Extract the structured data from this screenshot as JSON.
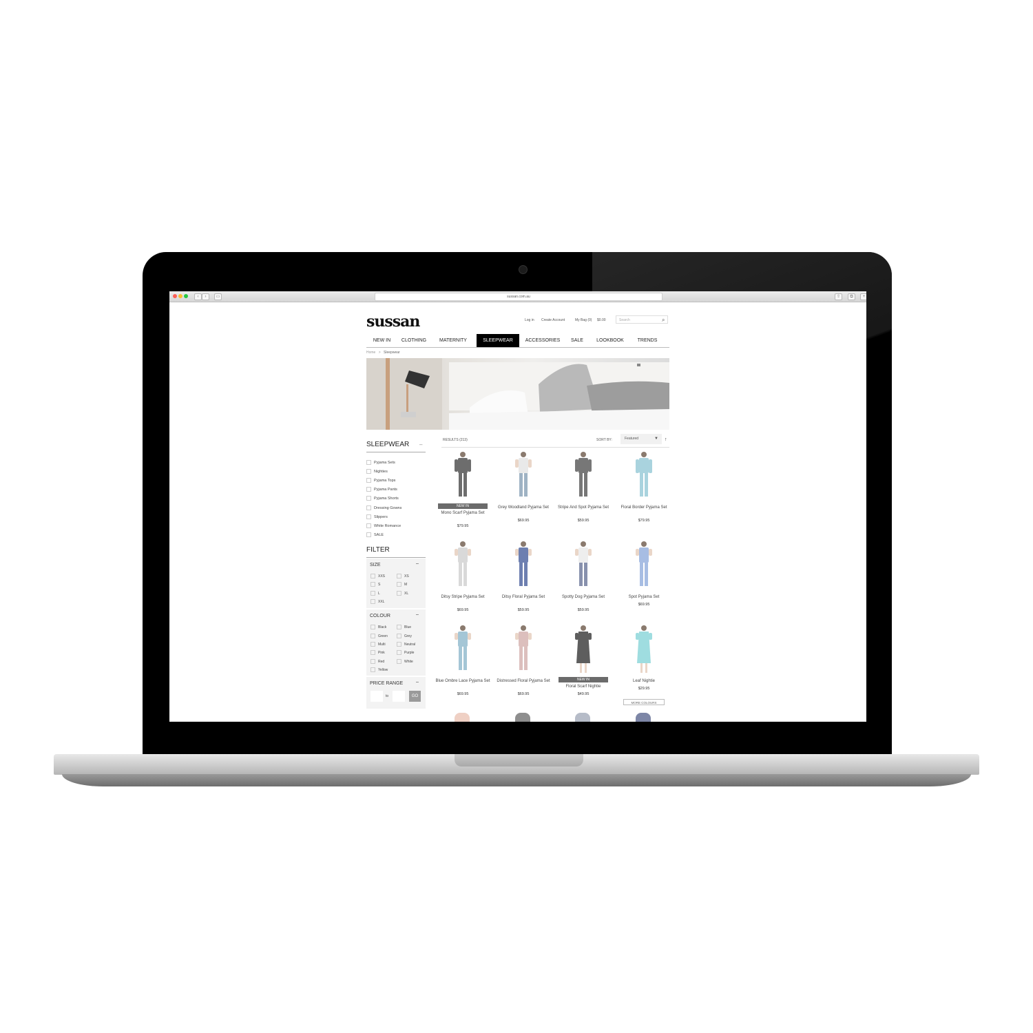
{
  "browser": {
    "url": "sussan.com.au"
  },
  "site": {
    "logo": "sussan",
    "top_links": [
      "Log in",
      "Create Account",
      "My Bag (0)",
      "$0.00"
    ],
    "search_placeholder": "Search",
    "nav": [
      "NEW IN",
      "CLOTHING",
      "MATERNITY",
      "SLEEPWEAR",
      "ACCESSORIES",
      "SALE",
      "LOOKBOOK",
      "TRENDS"
    ],
    "active_nav": "SLEEPWEAR",
    "breadcrumb": {
      "home": "Home",
      "sep": ">",
      "current": "Sleepwear"
    }
  },
  "sidebar": {
    "title": "SLEEPWEAR",
    "collapse": "–",
    "categories": [
      "Pyjama Sets",
      "Nighties",
      "Pyjama Tops",
      "Pyjama Pants",
      "Pyjama Shorts",
      "Dressing Gowns",
      "Slippers",
      "White Romance",
      "SALE"
    ],
    "filter_title": "FILTER",
    "size": {
      "label": "SIZE",
      "toggle": "–",
      "options": [
        "XXS",
        "XS",
        "S",
        "M",
        "L",
        "XL",
        "XXL"
      ]
    },
    "colour": {
      "label": "COLOUR",
      "toggle": "–",
      "options": [
        "Black",
        "Blue",
        "Green",
        "Grey",
        "Multi",
        "Neutral",
        "Pink",
        "Purple",
        "Red",
        "White",
        "Yellow"
      ]
    },
    "price": {
      "label": "PRICE RANGE",
      "toggle": "–",
      "to": "to",
      "go": "GO"
    }
  },
  "listing": {
    "results": "RESULTS (213)",
    "sort_label": "SORT BY:",
    "sort_value": "Featured",
    "sort_dir": "↑",
    "products": [
      {
        "name": "Mono Scarf Pyjama Set",
        "price": "$79.95",
        "badge": "NEW IN",
        "color": "#6d6d6d"
      },
      {
        "name": "Grey Woodland Pyjama Set",
        "price": "$69.95",
        "color": "#9fb3c4"
      },
      {
        "name": "Stripe And Spot Pyjama Set",
        "price": "$59.95",
        "color": "#777777"
      },
      {
        "name": "Floral Border Pyjama Set",
        "price": "$79.95",
        "color": "#a9d3de"
      },
      {
        "name": "Ditsy Stripe Pyjama Set",
        "price": "$69.95",
        "color": "#d9d9d9"
      },
      {
        "name": "Ditsy Floral Pyjama Set",
        "price": "$59.95",
        "color": "#6d7fb0"
      },
      {
        "name": "Spotty Dog Pyjama Set",
        "price": "$59.95",
        "color": "#8891ad"
      },
      {
        "name": "Spot Pyjama Set",
        "price": "$69.95",
        "color": "#a7bde3"
      },
      {
        "name": "Blue Ombre Lace Pyjama Set",
        "price": "$69.95",
        "color": "#a4c6d6"
      },
      {
        "name": "Distressed Floral Pyjama Set",
        "price": "$69.95",
        "color": "#dcbfbd"
      },
      {
        "name": "Floral Scarf Nightie",
        "price": "$49.95",
        "badge": "NEW IN",
        "color": "#5e5e5e"
      },
      {
        "name": "Leaf Nightie",
        "price": "$29.95",
        "more": "MORE COLOURS",
        "color": "#9fdde0"
      }
    ]
  }
}
